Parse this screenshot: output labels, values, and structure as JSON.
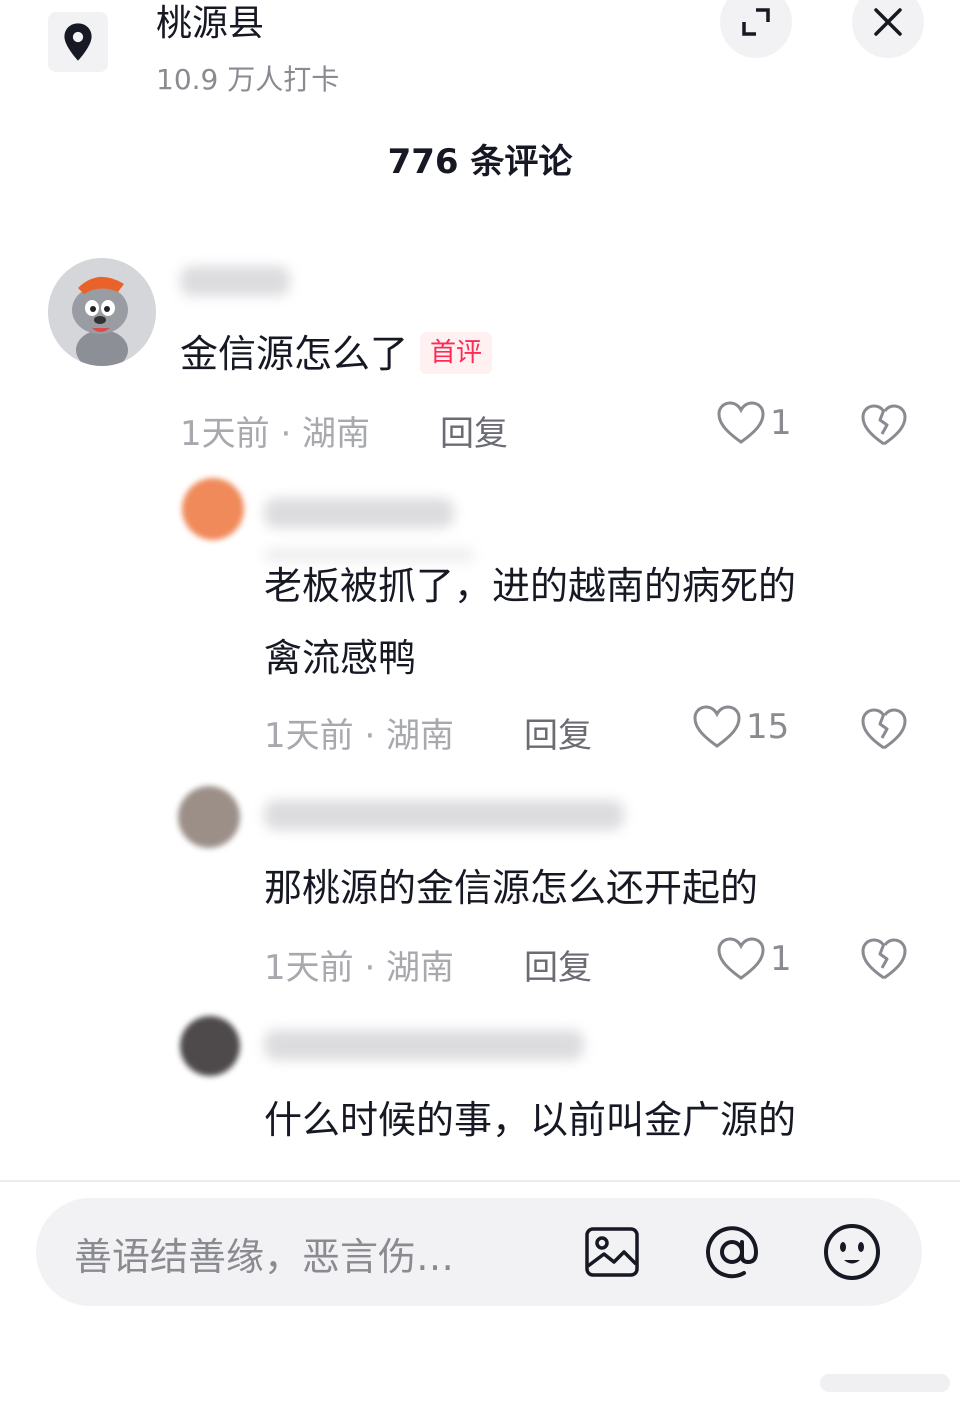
{
  "header": {
    "location_name": "桃源县",
    "checkins": "10.9 万人打卡",
    "comment_count": "776 条评论",
    "icons": [
      "location-pin-icon",
      "expand-icon",
      "close-icon"
    ]
  },
  "comments": [
    {
      "text": "金信源怎么了",
      "tag": "首评",
      "meta": "1天前 · 湖南",
      "reply_label": "回复",
      "likes": "1"
    },
    {
      "lines": [
        "老板被抓了，进的越南的病死的",
        "禽流感鸭"
      ],
      "meta": "1天前 · 湖南",
      "reply_label": "回复",
      "likes": "15"
    },
    {
      "text": "那桃源的金信源怎么还开起的",
      "meta": "1天前 · 湖南",
      "reply_label": "回复",
      "likes": "1"
    },
    {
      "text": "什么时候的事，以前叫金广源的"
    }
  ],
  "input": {
    "placeholder": "善语结善缘，恶言伤…",
    "icons": [
      "image-icon",
      "at-mention-icon",
      "emoji-icon"
    ]
  },
  "colors": {
    "accent": "#fe2c55",
    "text_primary": "#161823",
    "text_secondary": "#a8a9ae",
    "surface": "#f2f2f4"
  }
}
